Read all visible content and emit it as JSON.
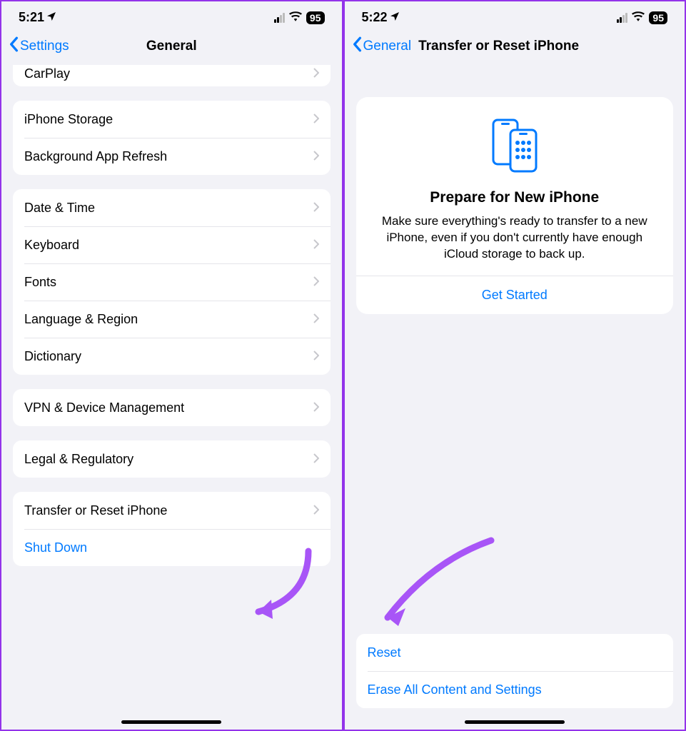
{
  "left": {
    "status": {
      "time": "5:21",
      "battery": "95"
    },
    "nav": {
      "back": "Settings",
      "title": "General"
    },
    "partial_row": "CarPlay",
    "group1": [
      "iPhone Storage",
      "Background App Refresh"
    ],
    "group2": [
      "Date & Time",
      "Keyboard",
      "Fonts",
      "Language & Region",
      "Dictionary"
    ],
    "group3": [
      "VPN & Device Management"
    ],
    "group4": [
      "Legal & Regulatory"
    ],
    "group5": [
      {
        "label": "Transfer or Reset iPhone",
        "link": false,
        "chevron": true
      },
      {
        "label": "Shut Down",
        "link": true,
        "chevron": false
      }
    ]
  },
  "right": {
    "status": {
      "time": "5:22",
      "battery": "95"
    },
    "nav": {
      "back": "General",
      "title": "Transfer or Reset iPhone"
    },
    "card": {
      "title": "Prepare for New iPhone",
      "desc": "Make sure everything's ready to transfer to a new iPhone, even if you don't currently have enough iCloud storage to back up.",
      "action": "Get Started"
    },
    "bottom": [
      "Reset",
      "Erase All Content and Settings"
    ]
  }
}
